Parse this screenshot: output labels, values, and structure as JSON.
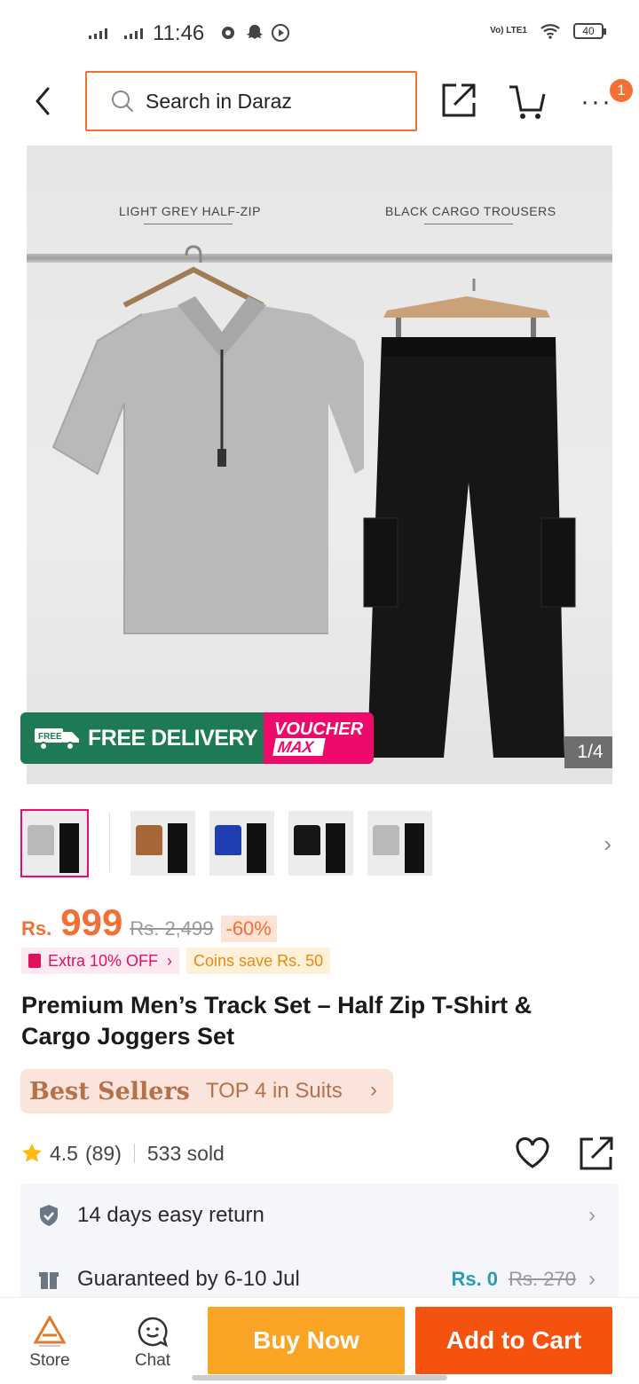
{
  "status_bar": {
    "time": "11:46",
    "battery": "40",
    "network": "Vo) LTE1"
  },
  "header": {
    "search_placeholder": "Search in Daraz",
    "cart_badge": "1",
    "icons": [
      "back-arrow-icon",
      "search-icon",
      "share-icon",
      "cart-icon",
      "more-icon"
    ]
  },
  "hero": {
    "label_left": "LIGHT GREY HALF-ZIP",
    "label_right": "BLACK CARGO TROUSERS",
    "free_delivery": "FREE DELIVERY",
    "free_tag": "FREE",
    "voucher_line1": "VOUCHER",
    "voucher_line2": "MAX",
    "image_counter": "1/4"
  },
  "thumbnails": [
    {
      "shirt_color": "#b9b9b9",
      "selected": true
    },
    {
      "shirt_color": "#a8653a",
      "selected": false
    },
    {
      "shirt_color": "#1f3fb0",
      "selected": false
    },
    {
      "shirt_color": "#161616",
      "selected": false
    },
    {
      "shirt_color": "#b9b9b9",
      "selected": false
    }
  ],
  "price": {
    "currency": "Rs.",
    "current": "999",
    "original": "Rs. 2,499",
    "discount": "-60%"
  },
  "promos": {
    "extra": "Extra 10% OFF",
    "coins": "Coins save Rs. 50"
  },
  "product": {
    "title": "Premium Men’s Track Set – Half Zip T-Shirt & Cargo Joggers Set"
  },
  "best_sellers": {
    "label": "Best Sellers",
    "rank": "TOP 4 in Suits"
  },
  "rating": {
    "score": "4.5",
    "count": "(89)",
    "sold": "533 sold"
  },
  "services": {
    "returns": "14 days easy return",
    "delivery": "Guaranteed by 6-10 Jul",
    "fee_now": "Rs. 0",
    "fee_was": "Rs. 270"
  },
  "bottom_bar": {
    "store": "Store",
    "chat": "Chat",
    "buy_now": "Buy Now",
    "add_to_cart": "Add to Cart"
  },
  "colors": {
    "accent": "#f36f36",
    "buy_now": "#f9a425",
    "add_to_cart": "#f5510f",
    "voucher_pink": "#ee0a6a",
    "delivery_green": "#1d7a55"
  }
}
